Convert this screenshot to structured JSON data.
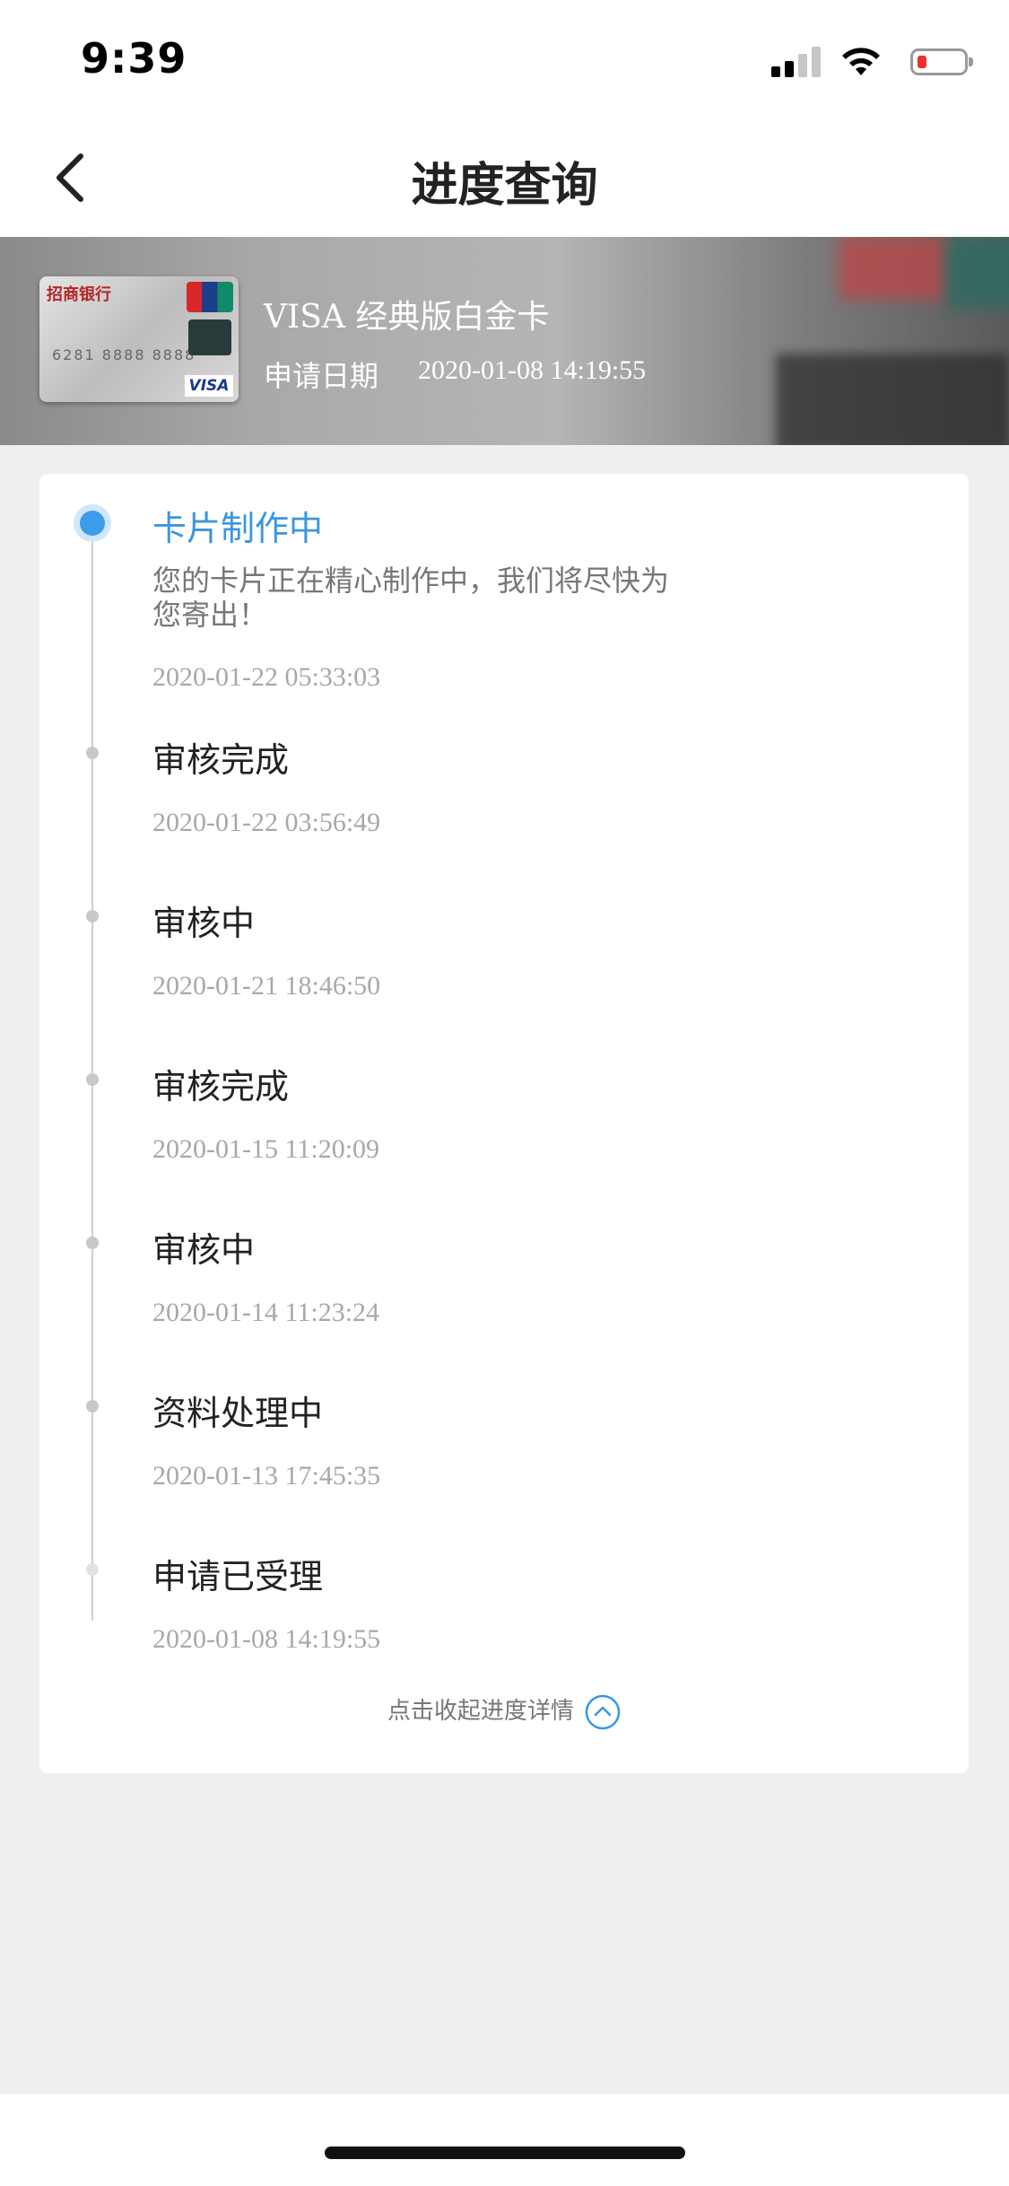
{
  "status_bar": {
    "time": "9:39"
  },
  "nav": {
    "title": "进度查询"
  },
  "card": {
    "bank_logo_text": "招商银行",
    "name": "VISA 经典版白金卡",
    "apply_label": "申请日期",
    "apply_date": "2020-01-08 14:19:55"
  },
  "timeline": [
    {
      "title": "卡片制作中",
      "desc": "您的卡片正在精心制作中，我们将尽快为您寄出！",
      "time": "2020-01-22 05:33:03",
      "active": true
    },
    {
      "title": "审核完成",
      "time": "2020-01-22 03:56:49"
    },
    {
      "title": "审核中",
      "time": "2020-01-21 18:46:50"
    },
    {
      "title": "审核完成",
      "time": "2020-01-15 11:20:09"
    },
    {
      "title": "审核中",
      "time": "2020-01-14 11:23:24"
    },
    {
      "title": "资料处理中",
      "time": "2020-01-13 17:45:35"
    },
    {
      "title": "申请已受理",
      "time": "2020-01-08 14:19:55"
    }
  ],
  "collapse_label": "点击收起进度详情",
  "colors": {
    "accent": "#3a96e0",
    "background": "#efefef"
  }
}
